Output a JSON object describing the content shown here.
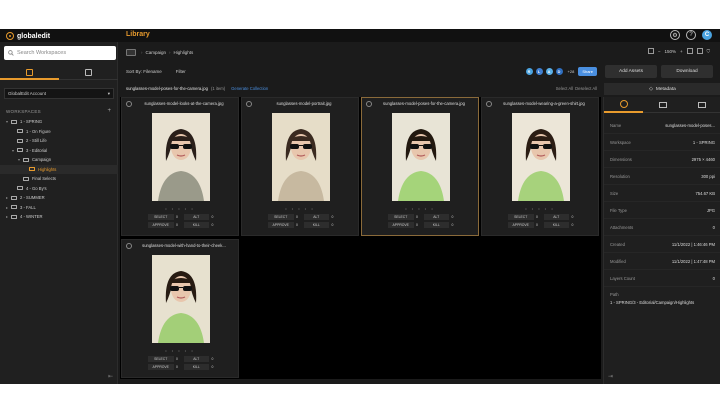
{
  "topbar": {
    "logo_text": "globaledit",
    "app_title": "Library",
    "avatar_initial": "C",
    "help_glyph": "?",
    "settings_glyph": "⚙"
  },
  "sidebar": {
    "search_placeholder": "Search Workspaces",
    "account": "GlobalEdit Account",
    "workspaces_label": "WORKSPACES",
    "tree": [
      {
        "label": "1 - SPRING",
        "indent": 0,
        "arrow": "▾",
        "selected": false
      },
      {
        "label": "1 - On Figure",
        "indent": 1,
        "arrow": "",
        "selected": false
      },
      {
        "label": "2 - Still Life",
        "indent": 1,
        "arrow": "",
        "selected": false
      },
      {
        "label": "3 - Editorial",
        "indent": 1,
        "arrow": "▾",
        "selected": false
      },
      {
        "label": "Campaign",
        "indent": 2,
        "arrow": "▾",
        "selected": false
      },
      {
        "label": "Highlights",
        "indent": 3,
        "arrow": "",
        "selected": true
      },
      {
        "label": "Final Selects",
        "indent": 2,
        "arrow": "",
        "selected": false
      },
      {
        "label": "4 - Go By's",
        "indent": 1,
        "arrow": "",
        "selected": false
      },
      {
        "label": "2 - SUMMER",
        "indent": 0,
        "arrow": "▸",
        "selected": false
      },
      {
        "label": "3 - FALL",
        "indent": 0,
        "arrow": "▸",
        "selected": false
      },
      {
        "label": "4 - WINTER",
        "indent": 0,
        "arrow": "▸",
        "selected": false
      }
    ]
  },
  "breadcrumb": {
    "items": [
      "Campaign",
      "Highlights"
    ]
  },
  "view_tools": {
    "zoom": "150%"
  },
  "sortbar": {
    "sort_label": "Sort By: Filename",
    "filter_label": "Filter",
    "more_count": "+28",
    "share_label": "Share",
    "collaborators": [
      {
        "initials": "R",
        "color": "#4aa3e0"
      },
      {
        "initials": "L",
        "color": "#3f7fd0"
      },
      {
        "initials": "A",
        "color": "#5bb0e8"
      },
      {
        "initials": "D",
        "color": "#2f6fc0"
      }
    ]
  },
  "actions": {
    "add_assets": "Add Assets",
    "download": "Download",
    "metadata_tab": "Metadata"
  },
  "collection": {
    "filename": "sunglasses-model-poses-for-the-camera.jpg",
    "count": "(1 item)",
    "generate": "Generate Collection",
    "select_all": "Select All",
    "deselect_all": "Deselect All"
  },
  "tag_labels": {
    "select": "SELECT",
    "alt": "ALT",
    "approve": "APPROVE",
    "kill": "KILL"
  },
  "cards": [
    {
      "name": "sunglasses-model-looks-at-the-camera.jpg",
      "counts": [
        "0",
        "0",
        "0",
        "0"
      ],
      "dots": "• • • • •"
    },
    {
      "name": "sunglasses-model-portrait.jpg",
      "counts": [
        "0",
        "0",
        "0",
        "0"
      ],
      "dots": "• • • • •"
    },
    {
      "name": "sunglasses-model-poses-for-the-camera.jpg",
      "counts": [
        "0",
        "0",
        "0",
        "0"
      ],
      "dots": "• • • • •"
    },
    {
      "name": "sunglasses-model-wearing-a-green-shirt.jpg",
      "counts": [
        "0",
        "0",
        "0",
        "0"
      ],
      "dots": "• • • • •"
    },
    {
      "name": "sunglasses-model-with-hand-to-their-cheek...",
      "counts": [
        "0",
        "0",
        "0",
        "0"
      ],
      "dots": "• • • • •"
    }
  ],
  "metadata": {
    "rows": [
      {
        "k": "Name",
        "v": "sunglasses-model-poses..."
      },
      {
        "k": "Workspace",
        "v": "1 - SPRING"
      },
      {
        "k": "Dimensions",
        "v": "2975 × 4460"
      },
      {
        "k": "Resolution",
        "v": "300 ppi"
      },
      {
        "k": "Size",
        "v": "754.67 KB"
      },
      {
        "k": "File Type",
        "v": "JPG"
      },
      {
        "k": "Attachments",
        "v": "0"
      },
      {
        "k": "Created",
        "v": "11/1/2022 | 1:46:46 PM"
      },
      {
        "k": "Modified",
        "v": "11/1/2022 | 1:47:48 PM"
      },
      {
        "k": "Layers Count",
        "v": "0"
      }
    ],
    "path_label": "Path",
    "path_value": "1 - SPRING/3 - Editorial/Campaign/Highlights"
  }
}
